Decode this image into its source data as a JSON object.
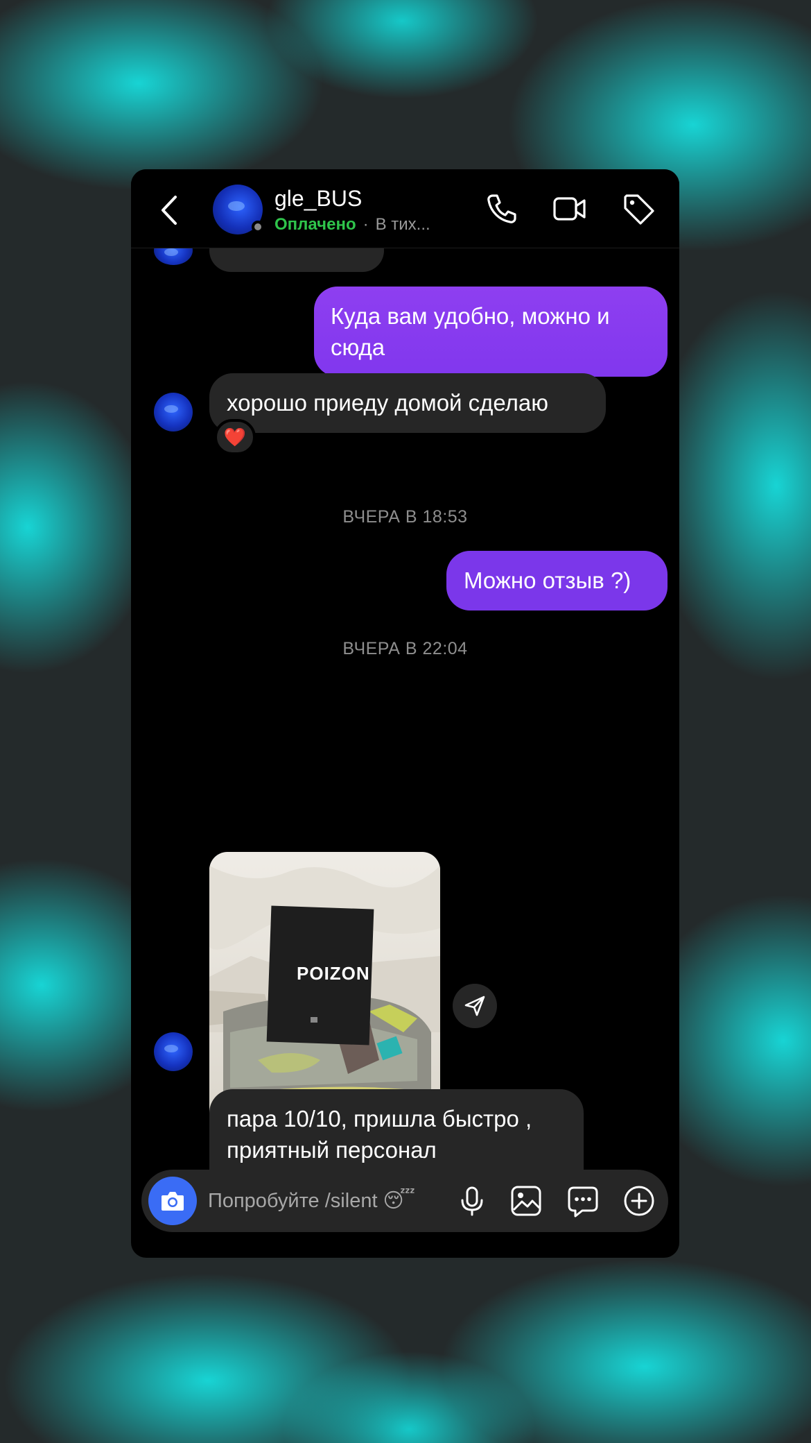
{
  "header": {
    "contact_name": "gle_BUS",
    "status": "Оплачено",
    "separator": "·",
    "extra": "В тих..."
  },
  "messages": {
    "msg1_out": "Куда вам удобно, можно и сюда",
    "msg2_in": "хорошо приеду домой сделаю",
    "msg2_reaction": "❤️",
    "timestamp1": "ВЧЕРА В 18:53",
    "msg3_out": "Можно отзыв ?)",
    "timestamp2": "ВЧЕРА В 22:04",
    "photo_brand": "POIZON",
    "msg4_in": "пара 10/10, пришла быстро , приятный персонал откликались всегда быстро",
    "msg4_reaction": "❤️"
  },
  "composer": {
    "placeholder": "Попробуйте /silent 😴"
  },
  "colors": {
    "out_bubble_top": "#8e3ff0",
    "out_bubble": "#7c3aed",
    "in_bubble": "#262626",
    "status_green": "#2fc44b",
    "camera_blue": "#3a6cf5",
    "background_cyan": "#18d4d4"
  },
  "icons": [
    "back-icon",
    "phone-icon",
    "video-icon",
    "tag-icon",
    "send-icon",
    "camera-icon",
    "microphone-icon",
    "gallery-icon",
    "chat-bubble-icon",
    "plus-icon"
  ]
}
